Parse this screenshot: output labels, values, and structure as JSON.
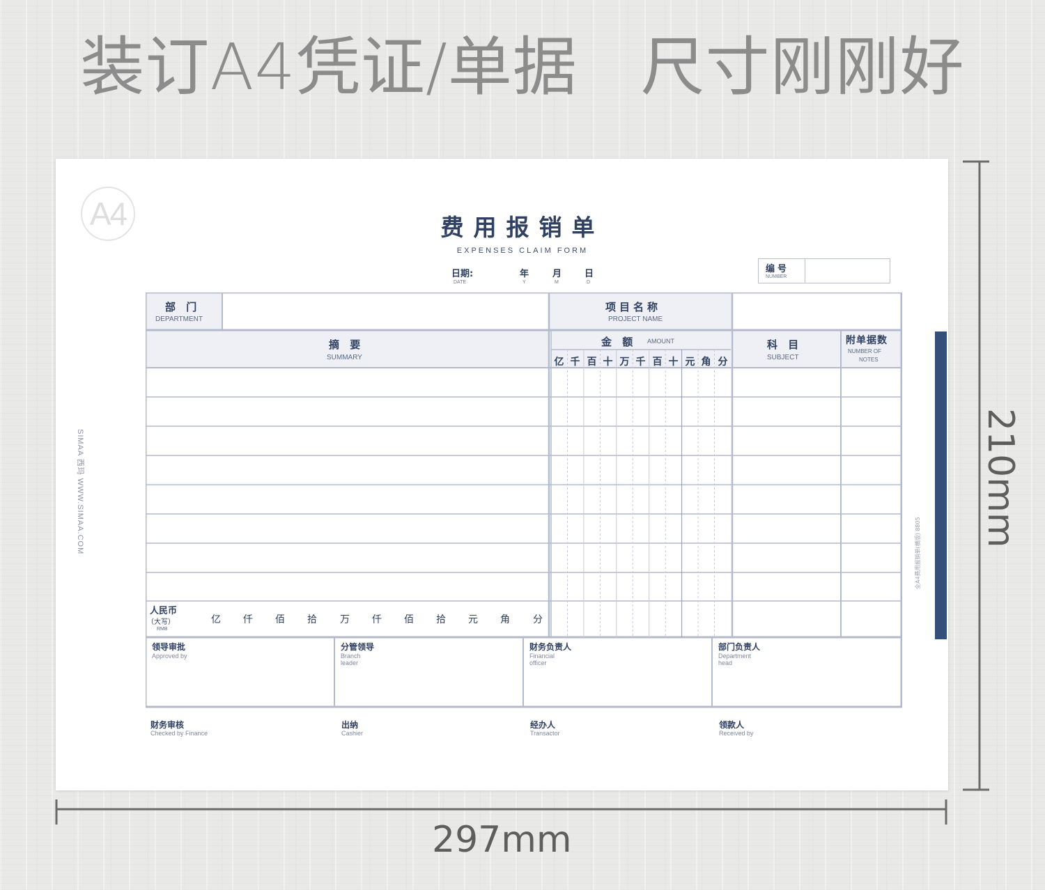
{
  "headline": "装订A4凭证/单据   尺寸刚刚好",
  "form": {
    "logo": "A4",
    "title": "费用报销单",
    "subtitle": "EXPENSES CLAIM FORM",
    "date": {
      "label_cn": "日期:",
      "label_en": "DATE",
      "year_cn": "年",
      "year_en": "Y",
      "month_cn": "月",
      "month_en": "M",
      "day_cn": "日",
      "day_en": "D"
    },
    "number": {
      "label_cn": "编号",
      "label_en": "NUMBER",
      "value": ""
    },
    "department": {
      "label_cn": "部 门",
      "label_en": "DEPARTMENT",
      "value": ""
    },
    "project": {
      "label_cn": "项目名称",
      "label_en": "PROJECT NAME",
      "value": ""
    },
    "summary": {
      "label_cn": "摘 要",
      "label_en": "SUMMARY"
    },
    "amount": {
      "label_cn": "金 额",
      "label_en": "AMOUNT",
      "digits": [
        "亿",
        "千",
        "百",
        "十",
        "万",
        "千",
        "百",
        "十",
        "元",
        "角",
        "分"
      ]
    },
    "subject": {
      "label_cn": "科 目",
      "label_en": "SUBJECT"
    },
    "notes": {
      "label_cn": "附单据数",
      "label_en_1": "NUMBER OF",
      "label_en_2": "NOTES"
    },
    "rmb": {
      "label_cn": "人民币",
      "label_cap": "（大写）",
      "label_en": "RMB",
      "units": [
        "亿",
        "仟",
        "佰",
        "拾",
        "万",
        "仟",
        "佰",
        "拾",
        "元",
        "角",
        "分"
      ]
    },
    "approvals": [
      {
        "cn": "领导审批",
        "en": "Approved by"
      },
      {
        "cn": "分管领导",
        "en": "Branch leader"
      },
      {
        "cn": "财务负责人",
        "en": "Financial officer"
      },
      {
        "cn": "部门负责人",
        "en": "Department head"
      }
    ],
    "signatures": [
      {
        "cn": "财务审核",
        "en": "Checked by Finance"
      },
      {
        "cn": "出纳",
        "en": "Cashier"
      },
      {
        "cn": "经办人",
        "en": "Transactor"
      },
      {
        "cn": "领款人",
        "en": "Received by"
      }
    ],
    "side_left": "SIMAA 西玛    WWW.SIMAA.COM",
    "side_right": "全A4费用报销单(横版)  8805"
  },
  "dimensions": {
    "width": "297mm",
    "height": "210mm"
  }
}
